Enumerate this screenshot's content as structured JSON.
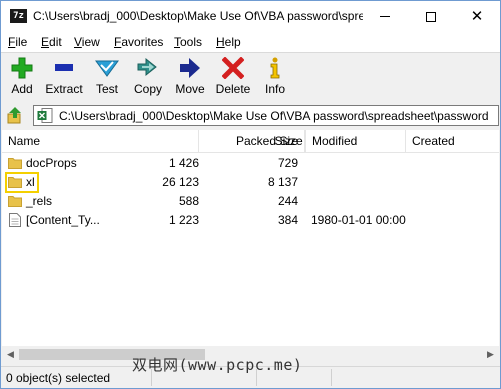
{
  "window": {
    "title": "C:\\Users\\bradj_000\\Desktop\\Make Use Of\\VBA password\\spre...",
    "app_icon_text": "7z",
    "minimize_icon": "minimize-icon",
    "maximize_icon": "maximize-icon",
    "close_icon": "close-icon"
  },
  "menu": {
    "items": [
      "File",
      "Edit",
      "View",
      "Favorites",
      "Tools",
      "Help"
    ]
  },
  "toolbar": {
    "buttons": [
      {
        "label": "Add",
        "icon": "plus-icon",
        "color": "#22aa22"
      },
      {
        "label": "Extract",
        "icon": "minus-icon",
        "color": "#1b2fb0"
      },
      {
        "label": "Test",
        "icon": "checkmark-icon",
        "color": "#2a9fd6"
      },
      {
        "label": "Copy",
        "icon": "double-arrow-icon",
        "color": "#2f8f8a"
      },
      {
        "label": "Move",
        "icon": "arrow-right-icon",
        "color": "#1b2a8f"
      },
      {
        "label": "Delete",
        "icon": "x-icon",
        "color": "#d42020"
      },
      {
        "label": "Info",
        "icon": "info-icon",
        "color": "#d4a000"
      }
    ]
  },
  "address": {
    "path": "C:\\Users\\bradj_000\\Desktop\\Make Use Of\\VBA password\\spreadsheet\\password",
    "up_icon": "up-folder-icon",
    "file_icon": "excel-file-icon"
  },
  "columns": {
    "name": "Name",
    "size": "Size",
    "packed": "Packed Size",
    "modified": "Modified",
    "created": "Created"
  },
  "rows": [
    {
      "name": "docProps",
      "size": "1 426",
      "packed": "729",
      "modified": "",
      "type": "folder"
    },
    {
      "name": "xl",
      "size": "26 123",
      "packed": "8 137",
      "modified": "",
      "type": "folder",
      "highlighted": true
    },
    {
      "name": "_rels",
      "size": "588",
      "packed": "244",
      "modified": "",
      "type": "folder"
    },
    {
      "name": "[Content_Ty...",
      "size": "1 223",
      "packed": "384",
      "modified": "1980-01-01 00:00",
      "type": "file"
    }
  ],
  "status": {
    "selected": "0 object(s) selected"
  },
  "watermark": "双电网(www.pcpc.me)",
  "colors": {
    "highlight_border": "#f4d000",
    "folder": "#e8c24a"
  }
}
